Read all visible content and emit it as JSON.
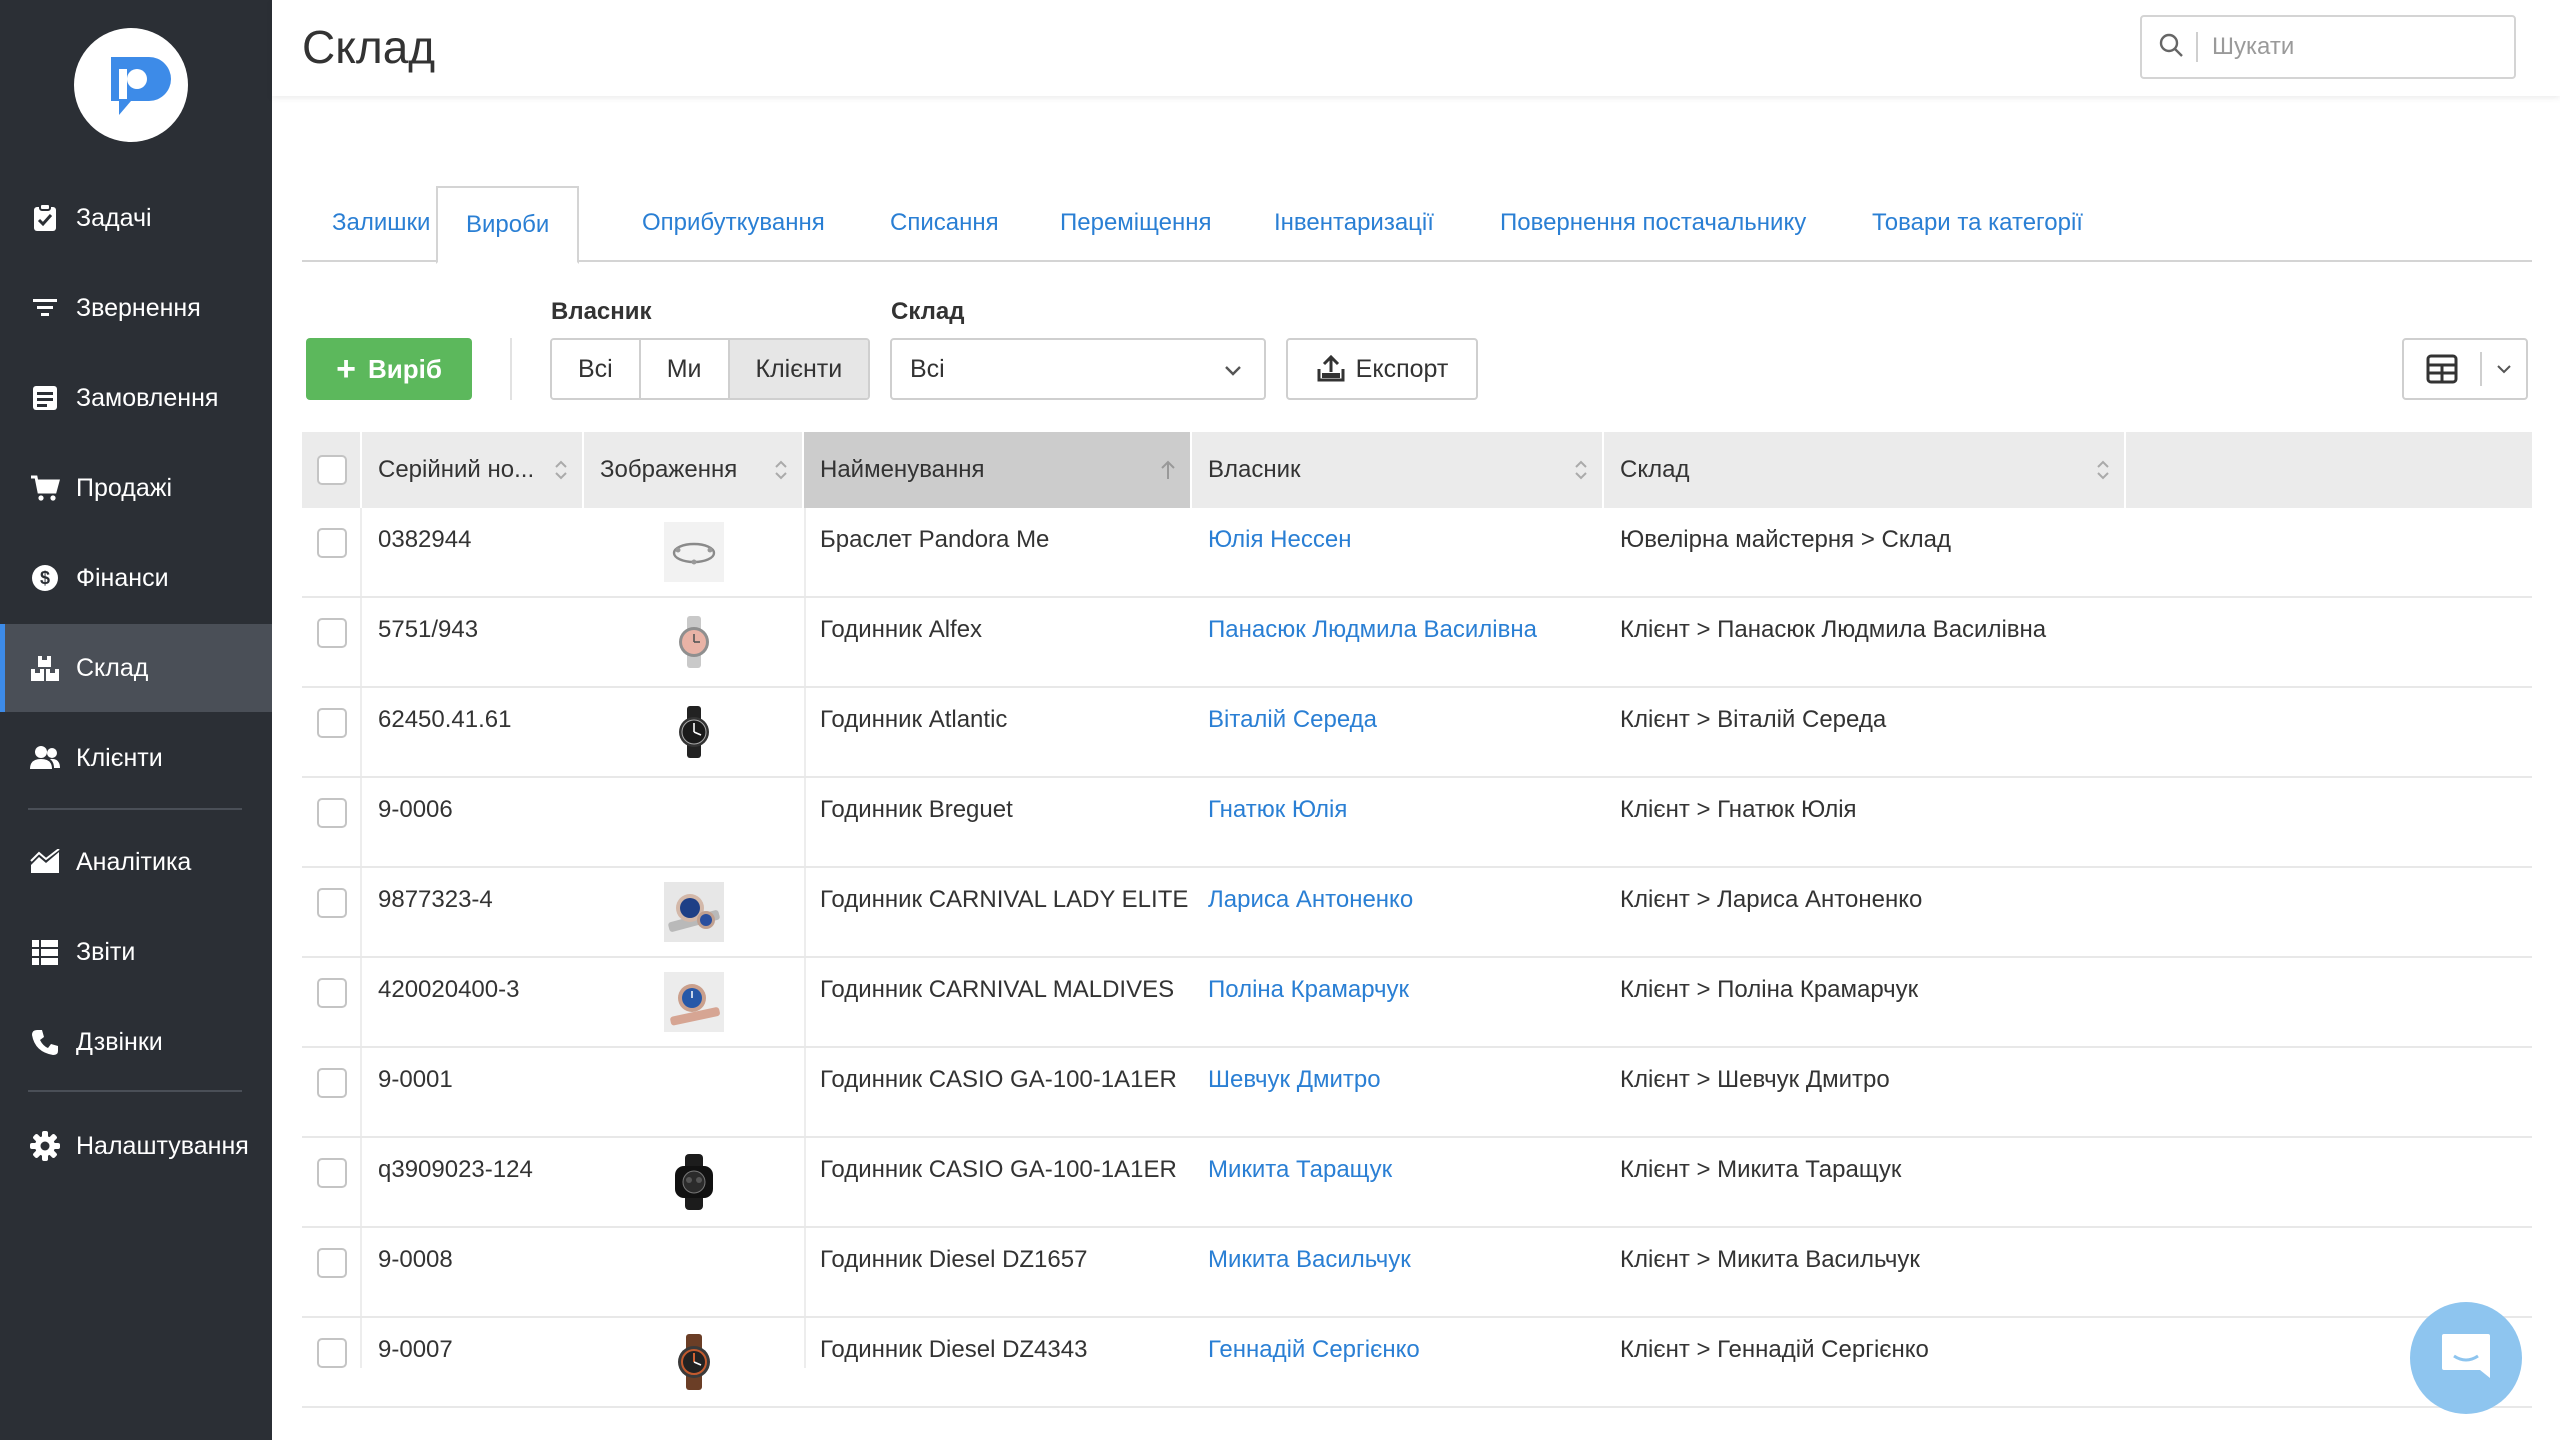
{
  "header": {
    "title": "Склад",
    "search_placeholder": "Шукати"
  },
  "sidebar": {
    "items": [
      {
        "label": "Задачі",
        "icon": "clipboard-check-icon"
      },
      {
        "label": "Звернення",
        "icon": "filter-icon"
      },
      {
        "label": "Замовлення",
        "icon": "order-list-icon"
      },
      {
        "label": "Продажі",
        "icon": "cart-icon"
      },
      {
        "label": "Фінанси",
        "icon": "dollar-circle-icon"
      },
      {
        "label": "Склад",
        "icon": "boxes-icon",
        "active": true
      },
      {
        "label": "Клієнти",
        "icon": "users-icon"
      },
      {
        "label": "Аналітика",
        "icon": "chart-area-icon"
      },
      {
        "label": "Звіти",
        "icon": "report-list-icon"
      },
      {
        "label": "Дзвінки",
        "icon": "phone-icon"
      },
      {
        "label": "Налаштування",
        "icon": "gear-icon"
      }
    ]
  },
  "tabs": [
    {
      "label": "Залишки"
    },
    {
      "label": "Вироби",
      "active": true
    },
    {
      "label": "Оприбуткування"
    },
    {
      "label": "Списання"
    },
    {
      "label": "Переміщення"
    },
    {
      "label": "Інвентаризації"
    },
    {
      "label": "Повернення постачальнику"
    },
    {
      "label": "Товари та категорії"
    }
  ],
  "toolbar": {
    "add_label": "Виріб",
    "owner_label": "Власник",
    "owner_options": [
      "Всі",
      "Ми",
      "Клієнти"
    ],
    "owner_selected": "Клієнти",
    "warehouse_label": "Склад",
    "warehouse_value": "Всі",
    "export_label": "Експорт"
  },
  "table": {
    "columns": [
      "Серійний но...",
      "Зображення",
      "Найменування",
      "Власник",
      "Склад"
    ],
    "sorted_column": "Найменування",
    "rows": [
      {
        "serial": "0382944",
        "image": "bracelet",
        "name": "Браслет Pandora Me",
        "owner": "Юлія Нессен",
        "warehouse": "Ювелірна майстерня > Склад"
      },
      {
        "serial": "5751/943",
        "image": "watch-pink",
        "name": "Годинник Alfex",
        "owner": "Панасюк Людмила Василівна",
        "warehouse": "Клієнт > Панасюк Людмила Василівна"
      },
      {
        "serial": "62450.41.61",
        "image": "watch-black",
        "name": "Годинник Atlantic",
        "owner": "Віталій Середа",
        "warehouse": "Клієнт > Віталій Середа"
      },
      {
        "serial": "9-0006",
        "image": "",
        "name": "Годинник Breguet",
        "owner": "Гнатюк Юлія",
        "warehouse": "Клієнт > Гнатюк Юлія"
      },
      {
        "serial": "9877323-4",
        "image": "watch-blue",
        "name": "Годинник CARNIVAL LADY ELITE",
        "owner": "Лариса Антоненко",
        "warehouse": "Клієнт > Лариса Антоненко"
      },
      {
        "serial": "420020400-3",
        "image": "watch-blue-rose",
        "name": "Годинник CARNIVAL MALDIVES",
        "owner": "Поліна Крамарчук",
        "warehouse": "Клієнт > Поліна Крамарчук"
      },
      {
        "serial": "9-0001",
        "image": "",
        "name": "Годинник CASIO GA-100-1A1ER",
        "owner": "Шевчук Дмитро",
        "warehouse": "Клієнт > Шевчук Дмитро"
      },
      {
        "serial": "q3909023-124",
        "image": "watch-gshock",
        "name": "Годинник CASIO GA-100-1A1ER",
        "owner": "Микита Таращук",
        "warehouse": "Клієнт > Микита Таращук"
      },
      {
        "serial": "9-0008",
        "image": "",
        "name": "Годинник Diesel DZ1657",
        "owner": "Микита Васильчук",
        "warehouse": "Клієнт > Микита Васильчук"
      },
      {
        "serial": "9-0007",
        "image": "watch-brown",
        "name": "Годинник Diesel DZ4343",
        "owner": "Геннадій Сергієнко",
        "warehouse": "Клієнт > Геннадій Сергієнко"
      }
    ]
  },
  "colors": {
    "sidebar": "#2b2f35",
    "accent": "#3d8be8",
    "link": "#2a7fd4",
    "add_button": "#5cb85c",
    "chat": "#8ec5ef"
  }
}
